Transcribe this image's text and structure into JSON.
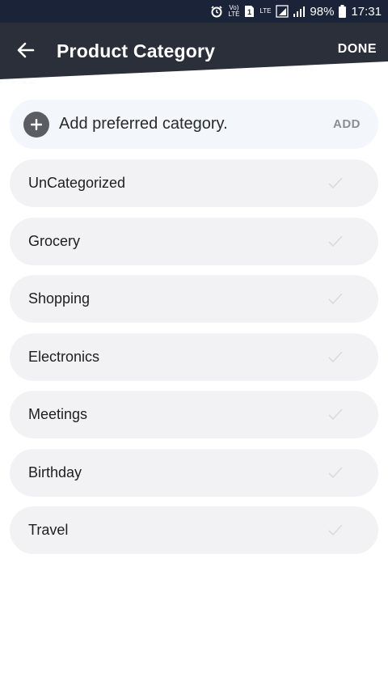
{
  "status_bar": {
    "battery_percent": "98%",
    "time": "17:31",
    "volte_label": "Vo) LTE",
    "sim_label": "1",
    "lte_label": "LTE"
  },
  "header": {
    "title": "Product Category",
    "done_label": "DONE"
  },
  "add_category": {
    "placeholder": "Add preferred category.",
    "add_label": "ADD"
  },
  "categories": [
    {
      "label": "UnCategorized"
    },
    {
      "label": "Grocery"
    },
    {
      "label": "Shopping"
    },
    {
      "label": "Electronics"
    },
    {
      "label": "Meetings"
    },
    {
      "label": "Birthday"
    },
    {
      "label": "Travel"
    }
  ],
  "colors": {
    "header_bg": "#2b2f3a",
    "status_bg": "#1b2338",
    "row_bg": "#f2f2f4",
    "add_row_bg": "#f3f6fa",
    "check_color": "#d9dadd"
  }
}
